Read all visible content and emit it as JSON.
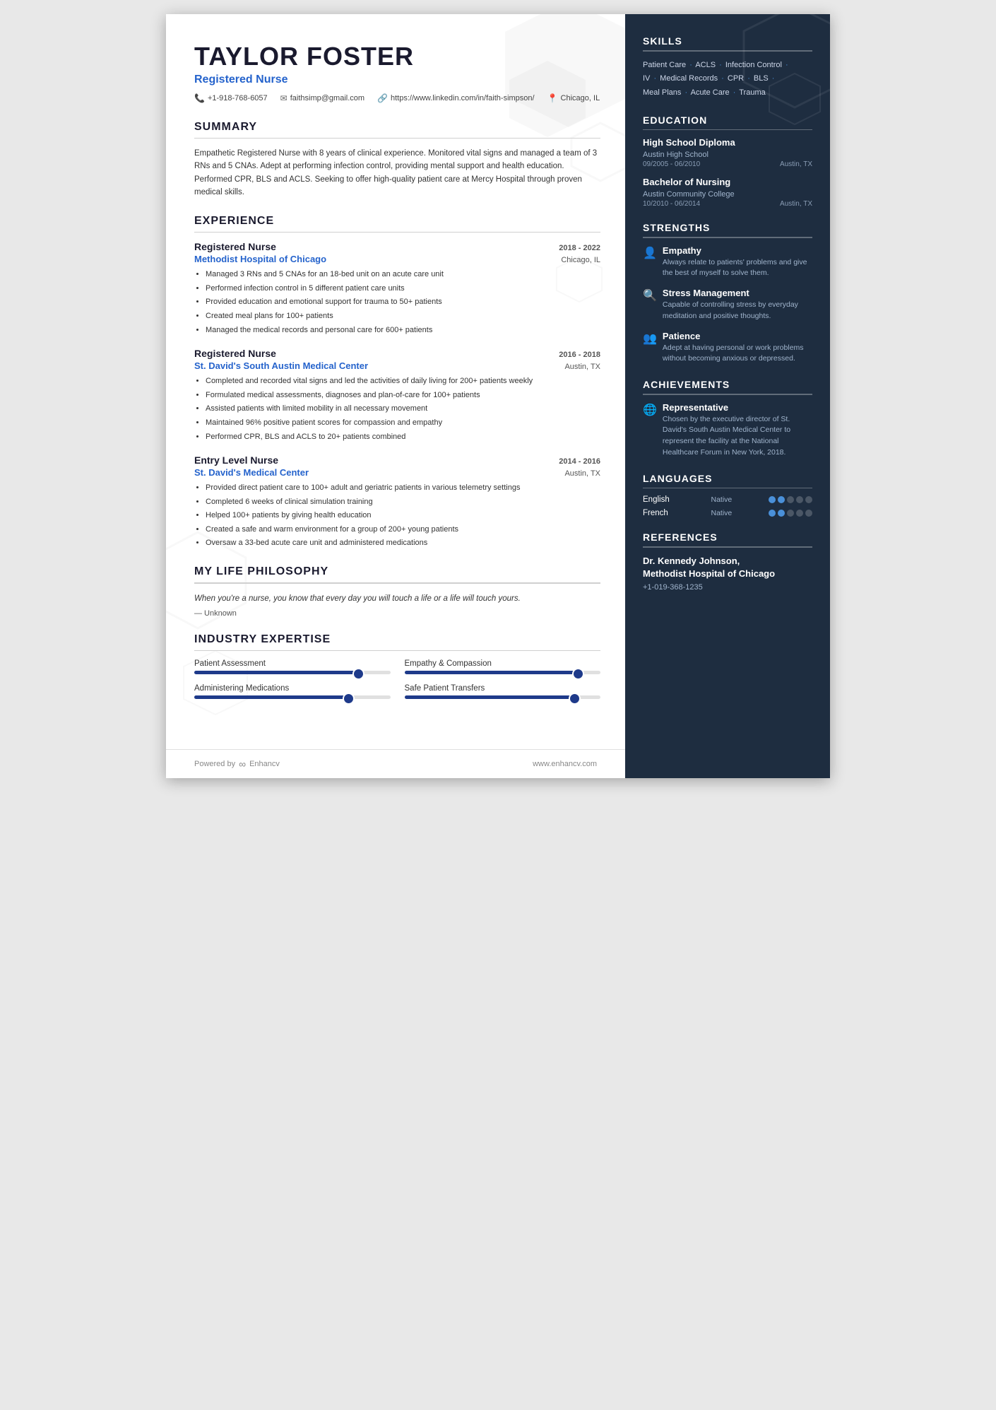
{
  "header": {
    "name": "TAYLOR FOSTER",
    "title": "Registered Nurse",
    "contact": {
      "phone": "+1-918-768-6057",
      "email": "faithsimp@gmail.com",
      "linkedin": "https://www.linkedin.com/in/faith-simpson/",
      "location": "Chicago, IL"
    }
  },
  "summary": {
    "title": "SUMMARY",
    "text": "Empathetic Registered Nurse with 8 years of clinical experience. Monitored vital signs and managed a team of 3 RNs and 5 CNAs. Adept at performing infection control, providing mental support and health education. Performed CPR, BLS and ACLS. Seeking to offer high-quality patient care at Mercy Hospital through proven medical skills."
  },
  "experience": {
    "title": "EXPERIENCE",
    "entries": [
      {
        "role": "Registered Nurse",
        "dates": "2018 - 2022",
        "company": "Methodist Hospital of Chicago",
        "location": "Chicago, IL",
        "bullets": [
          "Managed 3 RNs and 5 CNAs for an 18-bed unit on an acute care unit",
          "Performed infection control in 5 different patient care units",
          "Provided education and emotional support for trauma to 50+ patients",
          "Created meal plans for 100+ patients",
          "Managed the medical records and personal care for 600+ patients"
        ]
      },
      {
        "role": "Registered Nurse",
        "dates": "2016 - 2018",
        "company": "St. David's South Austin Medical Center",
        "location": "Austin, TX",
        "bullets": [
          "Completed and recorded vital signs and led the activities of daily living for 200+ patients weekly",
          "Formulated medical assessments, diagnoses and plan-of-care for 100+ patients",
          "Assisted patients with limited mobility in all necessary movement",
          "Maintained 96% positive patient scores for compassion and empathy",
          "Performed CPR, BLS and ACLS to 20+ patients combined"
        ]
      },
      {
        "role": "Entry Level Nurse",
        "dates": "2014 - 2016",
        "company": "St. David's Medical Center",
        "location": "Austin, TX",
        "bullets": [
          "Provided direct patient care to 100+ adult and geriatric patients in various telemetry settings",
          "Completed 6 weeks of clinical simulation training",
          "Helped 100+ patients by giving health education",
          "Created a safe and warm environment for a group of 200+ young patients",
          "Oversaw a 33-bed acute care unit and administered medications"
        ]
      }
    ]
  },
  "philosophy": {
    "title": "MY LIFE PHILOSOPHY",
    "text": "When you're a nurse, you know that every day you will touch a life or a life will touch yours.",
    "attribution": "— Unknown"
  },
  "expertise": {
    "title": "INDUSTRY EXPERTISE",
    "skills": [
      {
        "label": "Patient Assessment",
        "percent": 85
      },
      {
        "label": "Empathy & Compassion",
        "percent": 90
      },
      {
        "label": "Administering Medications",
        "percent": 80
      },
      {
        "label": "Safe Patient Transfers",
        "percent": 88
      }
    ]
  },
  "right": {
    "skills": {
      "title": "SKILLS",
      "items": [
        "Patient Care",
        "ACLS",
        "Infection Control",
        "IV",
        "Medical Records",
        "CPR",
        "BLS",
        "Meal Plans",
        "Acute Care",
        "Trauma"
      ]
    },
    "education": {
      "title": "EDUCATION",
      "entries": [
        {
          "degree": "High School Diploma",
          "school": "Austin High School",
          "dates": "09/2005 - 06/2010",
          "location": "Austin, TX"
        },
        {
          "degree": "Bachelor of Nursing",
          "school": "Austin Community College",
          "dates": "10/2010 - 06/2014",
          "location": "Austin, TX"
        }
      ]
    },
    "strengths": {
      "title": "STRENGTHS",
      "entries": [
        {
          "icon": "👤",
          "name": "Empathy",
          "desc": "Always relate to patients' problems and give the best of myself to solve them."
        },
        {
          "icon": "🔍",
          "name": "Stress Management",
          "desc": "Capable of controlling stress by everyday meditation and positive thoughts."
        },
        {
          "icon": "👥",
          "name": "Patience",
          "desc": "Adept at having personal or work problems without becoming anxious or depressed."
        }
      ]
    },
    "achievements": {
      "title": "ACHIEVEMENTS",
      "entries": [
        {
          "icon": "🌐",
          "name": "Representative",
          "desc": "Chosen by the executive director of St. David's South Austin Medical Center to represent the facility at the National Healthcare Forum in New York, 2018."
        }
      ]
    },
    "languages": {
      "title": "LANGUAGES",
      "entries": [
        {
          "name": "English",
          "level": "Native",
          "filled": 2,
          "total": 5
        },
        {
          "name": "French",
          "level": "Native",
          "filled": 2,
          "total": 5
        }
      ]
    },
    "references": {
      "title": "REFERENCES",
      "name": "Dr. Kennedy Johnson,\nMethodist Hospital of Chicago",
      "phone": "+1-019-368-1235"
    }
  },
  "footer": {
    "powered_by": "Powered by",
    "brand": "Enhancv",
    "website": "www.enhancv.com"
  }
}
